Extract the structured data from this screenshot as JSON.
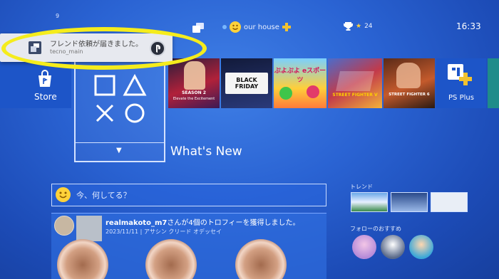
{
  "status_bar": {
    "notification_count": "9",
    "room_name": "our house",
    "trophy_count": "24",
    "clock": "16:33"
  },
  "notification": {
    "message": "フレンド依頼が届きました。",
    "user": "tecno_main"
  },
  "store": {
    "label": "Store"
  },
  "whats_new": {
    "label": "What's New"
  },
  "game_tiles": [
    {
      "title": "SEASON 2",
      "subtitle": "Elevate the Excitement"
    },
    {
      "title": "BLACK FRIDAY"
    },
    {
      "title": "ぷよぷよ eスポーツ"
    },
    {
      "title": "STREET FIGHTER V"
    },
    {
      "title": "STREET FIGHTER 6"
    },
    {
      "title": "PS Plus"
    }
  ],
  "composer": {
    "placeholder": "今、何してる？"
  },
  "activity": {
    "user": "realmakoto_m7",
    "action": "さんが4個のトロフィーを獲得しました。",
    "meta": "2023/11/11 | アサシン クリード オデッセイ"
  },
  "sidebar": {
    "trends_label": "トレンド",
    "follow_suggestions_label": "フォローのおすすめ"
  },
  "colors": {
    "background": "#2a63d3",
    "highlight_ring": "#f5ec1c",
    "toast_bg": "#e7e9ef"
  }
}
